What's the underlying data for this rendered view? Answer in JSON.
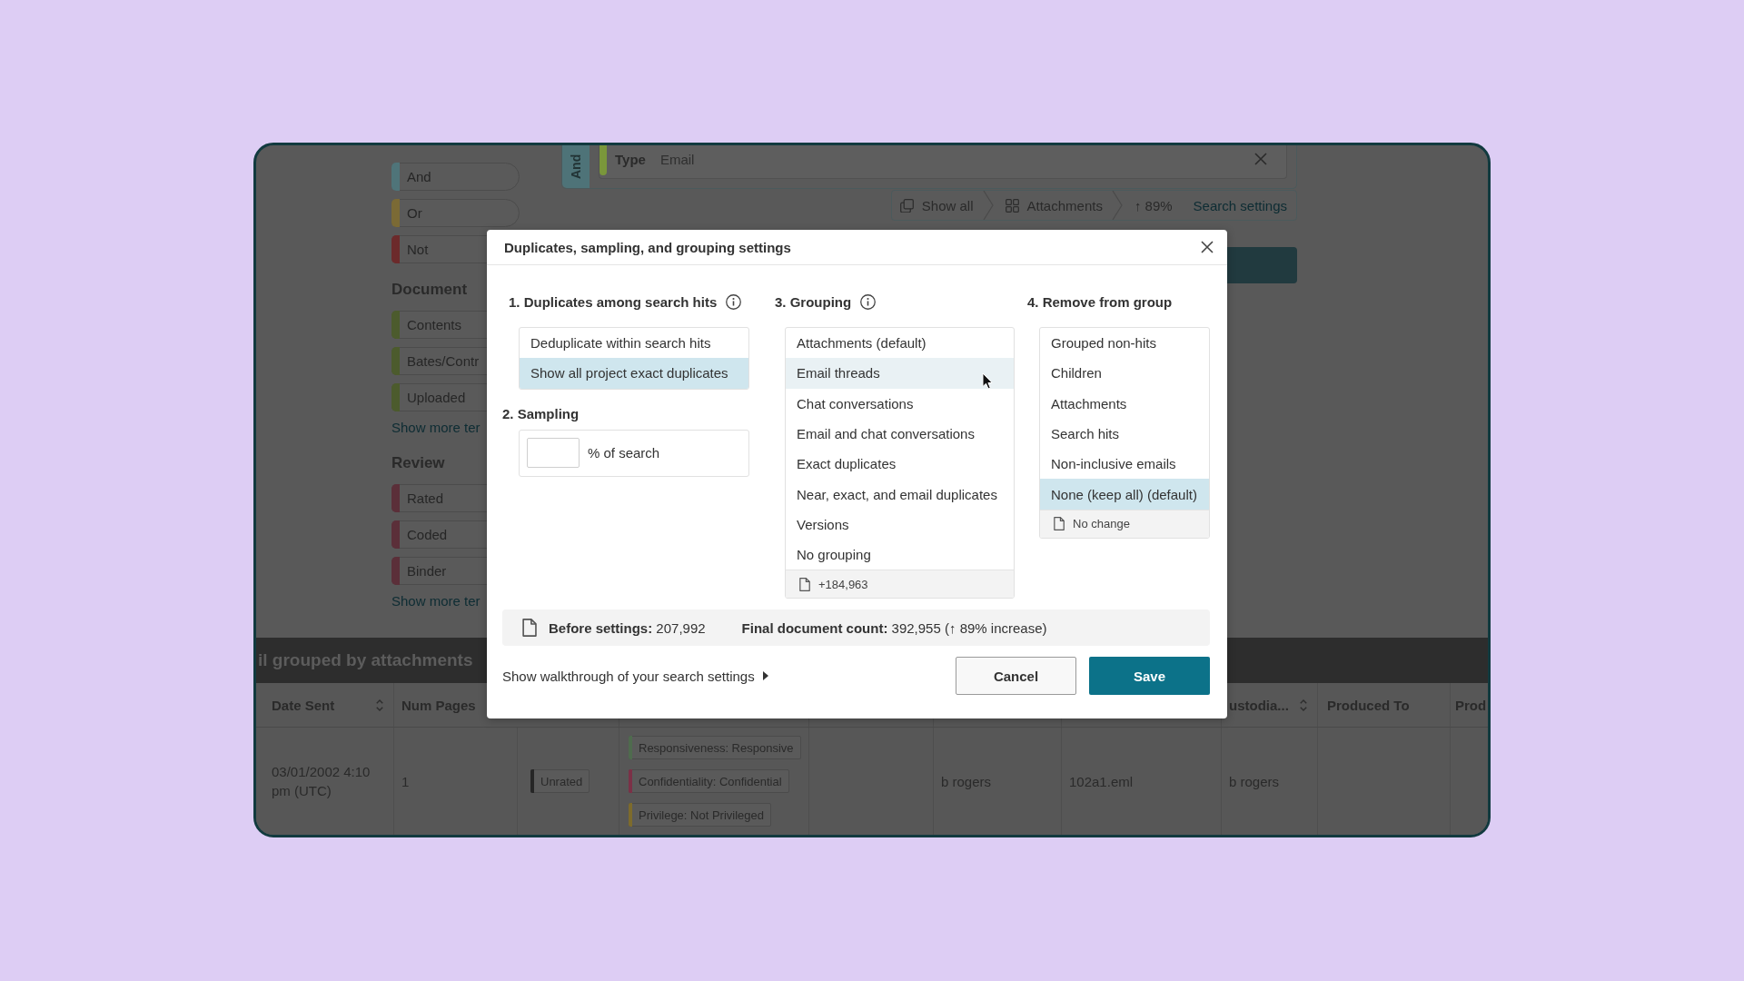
{
  "sidebar": {
    "groups": [
      {
        "items": [
          {
            "label": "And",
            "color": "#4f7479"
          },
          {
            "label": "Or",
            "color": "#7b6a35"
          },
          {
            "label": "Not",
            "color": "#6c2a2b"
          }
        ]
      },
      {
        "title": "Document",
        "items": [
          {
            "label": "Contents",
            "color": "#4c5b2d"
          },
          {
            "label": "Bates/Contr",
            "color": "#4c5b2d"
          },
          {
            "label": "Uploaded",
            "color": "#4c5b2d"
          }
        ],
        "more_link": "Show more ter"
      },
      {
        "title": "Review",
        "items": [
          {
            "label": "Rated",
            "color": "#5b2f39"
          },
          {
            "label": "Coded",
            "color": "#5b2f39"
          },
          {
            "label": "Binder",
            "color": "#5b2f39"
          }
        ],
        "more_link": "Show more ter"
      }
    ]
  },
  "query": {
    "operator": "And",
    "condition": {
      "field": "Type",
      "value": "Email",
      "color": "#7a973b"
    }
  },
  "breadcrumb": [
    {
      "kind": "copies",
      "label": "Show all"
    },
    {
      "kind": "grouping",
      "label": "Attachments"
    },
    {
      "kind": "change",
      "label": "↑ 89%"
    },
    {
      "kind": "link",
      "label": "Search settings"
    }
  ],
  "results": {
    "title": "il grouped by attachments",
    "columns": [
      {
        "kind": "heading",
        "label": "Date Sent",
        "sortable": true
      },
      {
        "kind": "heading",
        "label": "Num Pages",
        "sortable": false
      },
      {
        "kind": "covered"
      },
      {
        "kind": "covered"
      },
      {
        "kind": "covered"
      },
      {
        "kind": "covered"
      },
      {
        "kind": "covered"
      },
      {
        "kind": "heading",
        "label": "ustodia...",
        "sortable": true
      },
      {
        "kind": "heading",
        "label": "Produced To",
        "sortable": false
      },
      {
        "kind": "heading",
        "label": "Prod",
        "sortable": false
      }
    ],
    "rows": [
      {
        "cells": [
          {
            "kind": "text",
            "text": "03/01/2002 4:10 pm (UTC)"
          },
          {
            "kind": "text",
            "text": "1"
          },
          {
            "kind": "tags",
            "tags": [
              {
                "label": "Unrated",
                "color": "#262626"
              }
            ]
          },
          {
            "kind": "tags",
            "tags": [
              {
                "label": "Responsiveness: Responsive",
                "color": "#4f6b4e"
              },
              {
                "label": "Confidentiality: Confidential",
                "color": "#7b3147"
              },
              {
                "label": "Privilege: Not Privileged",
                "color": "#7d6b2c"
              }
            ]
          },
          {
            "kind": "empty"
          },
          {
            "kind": "text",
            "text": "b rogers"
          },
          {
            "kind": "text",
            "text": "102a1.eml"
          },
          {
            "kind": "text",
            "text": "b rogers"
          },
          {
            "kind": "empty"
          },
          {
            "kind": "empty"
          }
        ]
      }
    ]
  },
  "dialog": {
    "title": "Duplicates, sampling, and grouping settings",
    "duplicates": {
      "heading": "1. Duplicates among search hits",
      "options": [
        {
          "label": "Deduplicate within search hits",
          "selected": false
        },
        {
          "label": "Show all project exact duplicates",
          "selected": true
        }
      ]
    },
    "sampling": {
      "heading": "2. Sampling",
      "suffix": "% of search"
    },
    "grouping": {
      "heading": "3. Grouping",
      "options": [
        {
          "label": "Attachments (default)",
          "selected": false,
          "hovered": false
        },
        {
          "label": "Email threads",
          "selected": false,
          "hovered": true
        },
        {
          "label": "Chat conversations",
          "selected": false,
          "hovered": false
        },
        {
          "label": "Email and chat conversations",
          "selected": false,
          "hovered": false
        },
        {
          "label": "Exact duplicates",
          "selected": false,
          "hovered": false
        },
        {
          "label": "Near, exact, and email duplicates",
          "selected": false,
          "hovered": false
        },
        {
          "label": "Versions",
          "selected": false,
          "hovered": false
        },
        {
          "label": "No grouping",
          "selected": false,
          "hovered": false
        }
      ],
      "count": "+184,963"
    },
    "remove_from_group": {
      "heading": "4. Remove from group",
      "options": [
        {
          "label": "Grouped non-hits",
          "selected": false
        },
        {
          "label": "Children",
          "selected": false
        },
        {
          "label": "Attachments",
          "selected": false
        },
        {
          "label": "Search hits",
          "selected": false
        },
        {
          "label": "Non-inclusive emails",
          "selected": false
        },
        {
          "label": "None (keep all) (default)",
          "selected": true
        }
      ],
      "count": "No change"
    },
    "summary": {
      "before": "**Before settings:** 207,992",
      "final": "**Final document count:** 392,955 (↑ 89% increase)"
    },
    "walkthrough_link": "Show walkthrough of your search settings",
    "buttons": [
      {
        "label": "Cancel",
        "kind": "secondary"
      },
      {
        "label": "Save",
        "kind": "primary"
      }
    ]
  }
}
